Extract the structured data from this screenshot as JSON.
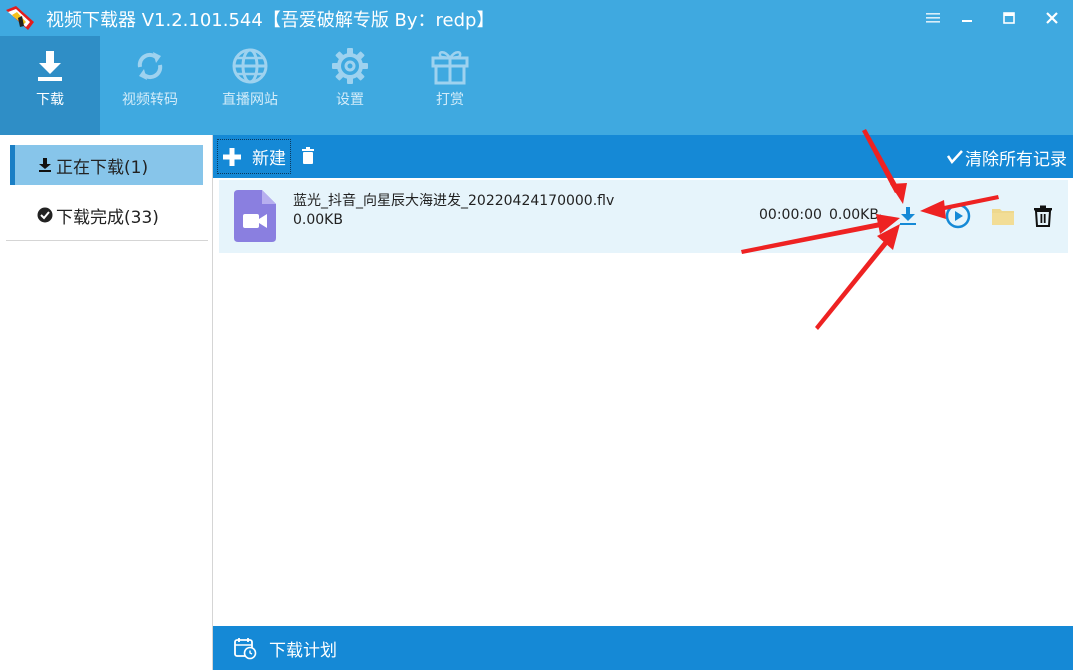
{
  "window": {
    "title": "视频下载器 V1.2.101.544【吾爱破解专版 By：redp】",
    "controls": [
      "menu-icon",
      "minimize-icon",
      "maximize-icon",
      "close-icon"
    ]
  },
  "toolbar": {
    "items": [
      {
        "label": "下载",
        "icon": "download-icon",
        "active": true
      },
      {
        "label": "视频转码",
        "icon": "convert-icon",
        "active": false
      },
      {
        "label": "直播网站",
        "icon": "globe-icon",
        "active": false
      },
      {
        "label": "设置",
        "icon": "gear-icon",
        "active": false
      },
      {
        "label": "打赏",
        "icon": "gift-icon",
        "active": false
      }
    ]
  },
  "sidebar": {
    "items": [
      {
        "label": "正在下载(1)",
        "icon": "download-icon",
        "active": true
      },
      {
        "label": "下载完成(33)",
        "icon": "check-circle-icon",
        "active": false
      }
    ]
  },
  "mainbar": {
    "new_label": "新建",
    "clear_label": "清除所有记录"
  },
  "downloads": [
    {
      "file_name": "蓝光_抖音_向星辰大海进发_20220424170000.flv",
      "size": "0.00KB",
      "elapsed": "00:00:00",
      "speed": "0.00KB/s",
      "actions": [
        "download-icon",
        "play-icon",
        "folder-icon",
        "trash-icon"
      ]
    }
  ],
  "bottom": {
    "label": "下载计划"
  },
  "colors": {
    "titlebar": "#3fa9e0",
    "toolbar_active": "#2f8ec6",
    "mainbar": "#1589d6",
    "row_bg": "#e6f4fb",
    "sidebar_active": "#87c5ea",
    "annotation_red": "#ee2222"
  }
}
